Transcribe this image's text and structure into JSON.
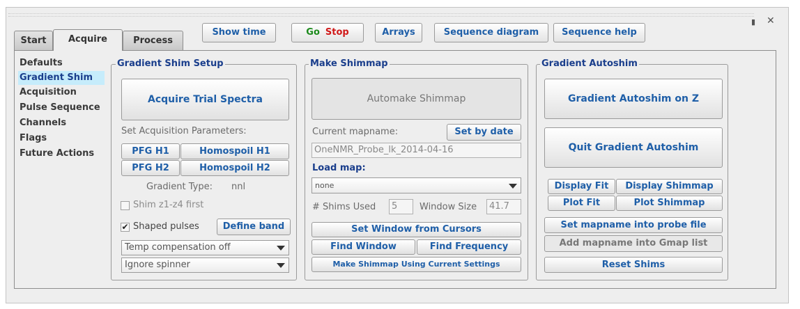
{
  "window": {
    "pin_icon": "pin-icon",
    "close_icon": "close-icon"
  },
  "tabs": [
    {
      "label": "Start"
    },
    {
      "label": "Acquire"
    },
    {
      "label": "Process"
    }
  ],
  "toolbar": {
    "show_time": "Show time",
    "go": "Go",
    "stop": "Stop",
    "arrays": "Arrays",
    "sequence_diagram": "Sequence diagram",
    "sequence_help": "Sequence help",
    "colors": {
      "go": "#1c8a1c",
      "stop": "#d01818"
    }
  },
  "sidebar": {
    "items": [
      {
        "label": "Defaults"
      },
      {
        "label": "Gradient Shim"
      },
      {
        "label": "Acquisition"
      },
      {
        "label": "Pulse Sequence"
      },
      {
        "label": "Channels"
      },
      {
        "label": "Flags"
      },
      {
        "label": "Future Actions"
      }
    ],
    "selected": "Gradient Shim"
  },
  "setup": {
    "title": "Gradient Shim Setup",
    "acquire_trial": "Acquire Trial Spectra",
    "set_params_label": "Set Acquisition Parameters:",
    "pfg_h1": "PFG H1",
    "homospoil_h1": "Homospoil H1",
    "pfg_h2": "PFG H2",
    "homospoil_h2": "Homospoil H2",
    "gradient_type_label": "Gradient Type:",
    "gradient_type_value": "nnl",
    "shim_z1z4": "Shim z1-z4 first",
    "shaped_pulses": "Shaped pulses",
    "shaped_checked": "✔",
    "define_band": "Define band",
    "temp_comp": "Temp compensation off",
    "spinner": "Ignore spinner"
  },
  "shimmap": {
    "title": "Make Shimmap",
    "automake": "Automake Shimmap",
    "current_mapname_label": "Current mapname:",
    "set_by_date": "Set by date",
    "mapname_value": "OneNMR_Probe_lk_2014-04-16",
    "load_map_label": "Load map:",
    "load_map_value": "none",
    "shims_used_label": "# Shims Used",
    "shims_used_value": "5",
    "window_size_label": "Window Size",
    "window_size_value": "41.7",
    "set_window": "Set Window from Cursors",
    "find_window": "Find Window",
    "find_frequency": "Find Frequency",
    "make_shimmap": "Make Shimmap Using Current Settings"
  },
  "autoshim": {
    "title": "Gradient Autoshim",
    "autoshim_z": "Gradient Autoshim on Z",
    "quit": "Quit Gradient Autoshim",
    "display_fit": "Display Fit",
    "display_shimmap": "Display Shimmap",
    "plot_fit": "Plot Fit",
    "plot_shimmap": "Plot Shimmap",
    "set_mapname": "Set mapname into probe file",
    "add_mapname": "Add mapname into Gmap list",
    "reset_shims": "Reset Shims"
  }
}
